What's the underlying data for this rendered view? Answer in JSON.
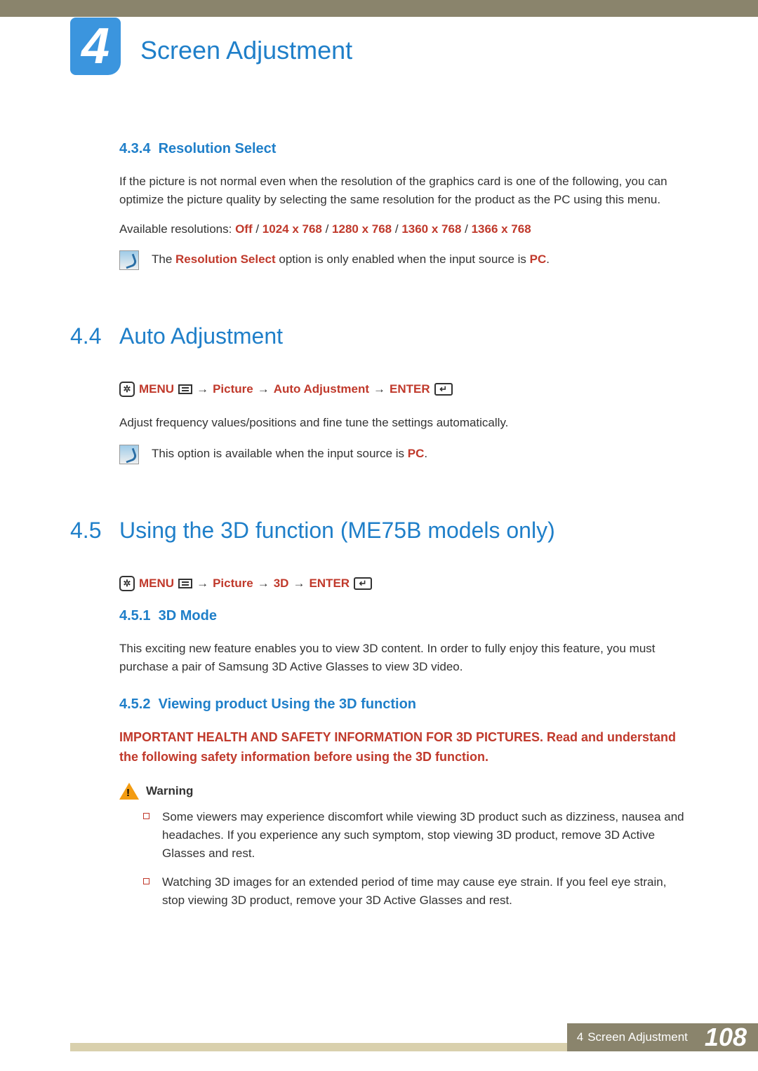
{
  "chapter": {
    "number": "4",
    "title": "Screen Adjustment"
  },
  "s434": {
    "num": "4.3.4",
    "title": "Resolution Select",
    "body": "If the picture is not normal even when the resolution of the graphics card is one of the following, you can optimize the picture quality by selecting the same resolution for the product as the PC using this menu.",
    "avail_label": "Available resolutions: ",
    "res": [
      "Off",
      "1024 x 768",
      "1280 x 768",
      "1360 x 768",
      "1366 x 768"
    ],
    "sep": " / ",
    "note_a": "The ",
    "note_b": "Resolution Select",
    "note_c": " option is only enabled when the input source is ",
    "note_d": "PC",
    "note_e": "."
  },
  "s44": {
    "num": "4.4",
    "title": "Auto Adjustment",
    "path": {
      "menu": "MENU",
      "p1": "Picture",
      "p2": "Auto Adjustment",
      "enter": "ENTER"
    },
    "body": "Adjust frequency values/positions and fine tune the settings automatically.",
    "note_a": "This option is available when the input source is ",
    "note_b": "PC",
    "note_c": "."
  },
  "s45": {
    "num": "4.5",
    "title": "Using the 3D function (ME75B models only)",
    "path": {
      "menu": "MENU",
      "p1": "Picture",
      "p2": "3D",
      "enter": "ENTER"
    }
  },
  "s451": {
    "num": "4.5.1",
    "title": "3D Mode",
    "body": "This exciting new feature enables you to view 3D content. In order to fully enjoy this feature, you must purchase a pair of Samsung 3D Active Glasses to view 3D video."
  },
  "s452": {
    "num": "4.5.2",
    "title": "Viewing product Using the 3D function",
    "safety": "IMPORTANT HEALTH AND SAFETY INFORMATION FOR 3D PICTURES. Read and understand the following safety information before using the 3D function.",
    "warning_label": "Warning",
    "bullets": [
      "Some viewers may experience discomfort while viewing 3D product such as dizziness, nausea and headaches. If you experience any such symptom, stop viewing 3D product, remove 3D Active Glasses and rest.",
      "Watching 3D images for an extended period of time may cause eye strain. If you feel eye strain, stop viewing 3D product, remove your 3D Active Glasses and rest."
    ]
  },
  "footer": {
    "chapter_num": "4",
    "chapter_title": "Screen Adjustment",
    "page": "108"
  }
}
